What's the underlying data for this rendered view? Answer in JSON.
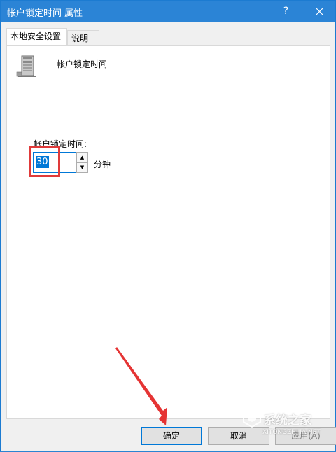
{
  "window": {
    "title": "帐户锁定时间 属性",
    "help_glyph": "?",
    "close_icon": "close-icon"
  },
  "tabs": [
    {
      "label": "本地安全设置",
      "active": true
    },
    {
      "label": "说明",
      "active": false
    }
  ],
  "policy": {
    "icon": "server-icon",
    "name": "帐户锁定时间"
  },
  "field": {
    "label": "帐户锁定时间:",
    "value": "30",
    "unit": "分钟"
  },
  "buttons": {
    "ok": "确定",
    "cancel": "取消",
    "apply": "应用(A)"
  },
  "watermark": {
    "text": "系统之家",
    "url": "XITONGZHIJIA.NET"
  },
  "colors": {
    "titlebar": "#2b84d6",
    "selection": "#0078d7",
    "annotation": "#e03a3a"
  }
}
